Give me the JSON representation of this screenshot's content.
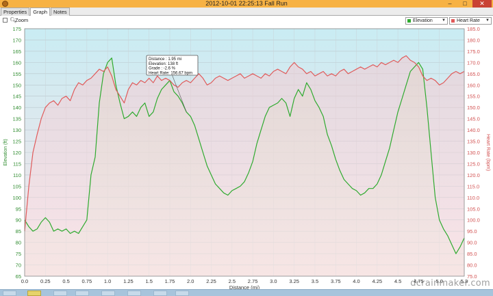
{
  "window": {
    "title": "2012-10-01 22:25:13 Fall Run",
    "minimize": "–",
    "maximize": "□",
    "close": "✕"
  },
  "tabs": [
    {
      "label": "Properties",
      "active": false
    },
    {
      "label": "Graph",
      "active": true
    },
    {
      "label": "Notes",
      "active": false
    }
  ],
  "toolbar": {
    "zoom_label": "Zoom",
    "zoom_checked": false,
    "left_series": {
      "label": "Elevation",
      "color": "#2eaa2e"
    },
    "right_series": {
      "label": "Heart Rate",
      "color": "#e05a5a"
    }
  },
  "watermark": "dcrainmaker.com",
  "chart_data": {
    "type": "line",
    "xlabel": "Distance (mi)",
    "ylabel_left": "Elevation (ft)",
    "ylabel_right": "Heart Rate (bpm)",
    "xlim": [
      0,
      5.3
    ],
    "ylim_left": [
      65,
      175
    ],
    "ylim_right": [
      75,
      185
    ],
    "x_ticks": [
      "0.0",
      "0.25",
      "0.5",
      "0.75",
      "1.0",
      "1.25",
      "1.5",
      "1.75",
      "2.0",
      "2.25",
      "2.5",
      "2.75",
      "3.0",
      "3.25",
      "3.5",
      "3.75",
      "4.0",
      "4.25",
      "4.5",
      "4.75",
      "5.0",
      "5.3"
    ],
    "y_left_ticks": [
      "65",
      "70",
      "75",
      "80",
      "85",
      "90",
      "95",
      "100",
      "105",
      "110",
      "115",
      "120",
      "125",
      "130",
      "135",
      "140",
      "145",
      "150",
      "155",
      "160",
      "165",
      "170",
      "175"
    ],
    "y_right_ticks": [
      "75.0",
      "80.0",
      "85.0",
      "90.0",
      "95.0",
      "100.0",
      "105.0",
      "110.0",
      "115.0",
      "120.0",
      "125.0",
      "130.0",
      "135.0",
      "140.0",
      "145.0",
      "150.0",
      "155.0",
      "160.0",
      "165.0",
      "170.0",
      "175.0",
      "180.0",
      "185.0"
    ],
    "grid": true,
    "series": [
      {
        "name": "Elevation",
        "axis": "left",
        "color": "#2eaa2e",
        "points": [
          [
            0,
            90
          ],
          [
            0.05,
            87
          ],
          [
            0.1,
            85
          ],
          [
            0.15,
            86
          ],
          [
            0.2,
            89
          ],
          [
            0.25,
            91
          ],
          [
            0.3,
            89
          ],
          [
            0.35,
            85
          ],
          [
            0.4,
            86
          ],
          [
            0.45,
            85
          ],
          [
            0.5,
            86
          ],
          [
            0.55,
            84
          ],
          [
            0.6,
            85
          ],
          [
            0.65,
            84
          ],
          [
            0.7,
            87
          ],
          [
            0.75,
            90
          ],
          [
            0.8,
            110
          ],
          [
            0.85,
            118
          ],
          [
            0.9,
            142
          ],
          [
            0.95,
            155
          ],
          [
            1.0,
            160
          ],
          [
            1.05,
            162
          ],
          [
            1.1,
            150
          ],
          [
            1.15,
            142
          ],
          [
            1.2,
            135
          ],
          [
            1.25,
            136
          ],
          [
            1.3,
            138
          ],
          [
            1.35,
            136
          ],
          [
            1.4,
            140
          ],
          [
            1.45,
            142
          ],
          [
            1.5,
            136
          ],
          [
            1.55,
            138
          ],
          [
            1.6,
            144
          ],
          [
            1.65,
            148
          ],
          [
            1.7,
            150
          ],
          [
            1.75,
            152
          ],
          [
            1.8,
            147
          ],
          [
            1.85,
            145
          ],
          [
            1.9,
            142
          ],
          [
            1.95,
            138
          ],
          [
            2.0,
            136
          ],
          [
            2.05,
            132
          ],
          [
            2.1,
            126
          ],
          [
            2.15,
            120
          ],
          [
            2.2,
            114
          ],
          [
            2.25,
            110
          ],
          [
            2.3,
            106
          ],
          [
            2.35,
            104
          ],
          [
            2.4,
            102
          ],
          [
            2.45,
            101
          ],
          [
            2.5,
            103
          ],
          [
            2.55,
            104
          ],
          [
            2.6,
            105
          ],
          [
            2.65,
            107
          ],
          [
            2.7,
            111
          ],
          [
            2.75,
            116
          ],
          [
            2.8,
            124
          ],
          [
            2.85,
            130
          ],
          [
            2.9,
            136
          ],
          [
            2.95,
            140
          ],
          [
            3.0,
            141
          ],
          [
            3.05,
            142
          ],
          [
            3.1,
            144
          ],
          [
            3.15,
            142
          ],
          [
            3.2,
            136
          ],
          [
            3.25,
            144
          ],
          [
            3.3,
            148
          ],
          [
            3.35,
            145
          ],
          [
            3.4,
            151
          ],
          [
            3.45,
            148
          ],
          [
            3.5,
            143
          ],
          [
            3.55,
            140
          ],
          [
            3.6,
            136
          ],
          [
            3.65,
            128
          ],
          [
            3.7,
            123
          ],
          [
            3.75,
            117
          ],
          [
            3.8,
            112
          ],
          [
            3.85,
            108
          ],
          [
            3.9,
            106
          ],
          [
            3.95,
            104
          ],
          [
            4.0,
            103
          ],
          [
            4.05,
            101
          ],
          [
            4.1,
            102
          ],
          [
            4.15,
            104
          ],
          [
            4.2,
            104
          ],
          [
            4.25,
            106
          ],
          [
            4.3,
            110
          ],
          [
            4.35,
            116
          ],
          [
            4.4,
            122
          ],
          [
            4.45,
            130
          ],
          [
            4.5,
            138
          ],
          [
            4.55,
            144
          ],
          [
            4.6,
            150
          ],
          [
            4.65,
            156
          ],
          [
            4.7,
            158
          ],
          [
            4.75,
            160
          ],
          [
            4.8,
            157
          ],
          [
            4.85,
            140
          ],
          [
            4.9,
            120
          ],
          [
            4.95,
            100
          ],
          [
            5.0,
            90
          ],
          [
            5.05,
            86
          ],
          [
            5.1,
            83
          ],
          [
            5.15,
            79
          ],
          [
            5.2,
            75
          ],
          [
            5.25,
            78
          ],
          [
            5.3,
            82
          ]
        ]
      },
      {
        "name": "Heart Rate",
        "axis": "right",
        "color": "#e05a5a",
        "points": [
          [
            0,
            95
          ],
          [
            0.05,
            115
          ],
          [
            0.1,
            130
          ],
          [
            0.15,
            138
          ],
          [
            0.2,
            145
          ],
          [
            0.25,
            150
          ],
          [
            0.3,
            152
          ],
          [
            0.35,
            153
          ],
          [
            0.4,
            151
          ],
          [
            0.45,
            154
          ],
          [
            0.5,
            155
          ],
          [
            0.55,
            153
          ],
          [
            0.6,
            158
          ],
          [
            0.65,
            161
          ],
          [
            0.7,
            160
          ],
          [
            0.75,
            162
          ],
          [
            0.8,
            163
          ],
          [
            0.85,
            165
          ],
          [
            0.9,
            167
          ],
          [
            0.95,
            166
          ],
          [
            1.0,
            168
          ],
          [
            1.05,
            164
          ],
          [
            1.1,
            158
          ],
          [
            1.15,
            155
          ],
          [
            1.2,
            152
          ],
          [
            1.25,
            158
          ],
          [
            1.3,
            161
          ],
          [
            1.35,
            160
          ],
          [
            1.4,
            162
          ],
          [
            1.45,
            161
          ],
          [
            1.5,
            163
          ],
          [
            1.55,
            161
          ],
          [
            1.6,
            164
          ],
          [
            1.65,
            162
          ],
          [
            1.7,
            163
          ],
          [
            1.75,
            162
          ],
          [
            1.8,
            160
          ],
          [
            1.85,
            159
          ],
          [
            1.9,
            161
          ],
          [
            1.95,
            162
          ],
          [
            2.0,
            161
          ],
          [
            2.05,
            163
          ],
          [
            2.1,
            165
          ],
          [
            2.15,
            163
          ],
          [
            2.2,
            160
          ],
          [
            2.25,
            161
          ],
          [
            2.3,
            163
          ],
          [
            2.35,
            164
          ],
          [
            2.4,
            163
          ],
          [
            2.45,
            162
          ],
          [
            2.5,
            163
          ],
          [
            2.55,
            164
          ],
          [
            2.6,
            165
          ],
          [
            2.65,
            163
          ],
          [
            2.7,
            164
          ],
          [
            2.75,
            165
          ],
          [
            2.8,
            164
          ],
          [
            2.85,
            163
          ],
          [
            2.9,
            165
          ],
          [
            2.95,
            164
          ],
          [
            3.0,
            166
          ],
          [
            3.05,
            167
          ],
          [
            3.1,
            166
          ],
          [
            3.15,
            165
          ],
          [
            3.2,
            168
          ],
          [
            3.25,
            170
          ],
          [
            3.3,
            168
          ],
          [
            3.35,
            167
          ],
          [
            3.4,
            165
          ],
          [
            3.45,
            166
          ],
          [
            3.5,
            164
          ],
          [
            3.55,
            165
          ],
          [
            3.6,
            166
          ],
          [
            3.65,
            164
          ],
          [
            3.7,
            165
          ],
          [
            3.75,
            164
          ],
          [
            3.8,
            166
          ],
          [
            3.85,
            167
          ],
          [
            3.9,
            165
          ],
          [
            3.95,
            166
          ],
          [
            4.0,
            167
          ],
          [
            4.05,
            168
          ],
          [
            4.1,
            167
          ],
          [
            4.15,
            168
          ],
          [
            4.2,
            169
          ],
          [
            4.25,
            168
          ],
          [
            4.3,
            170
          ],
          [
            4.35,
            169
          ],
          [
            4.4,
            170
          ],
          [
            4.45,
            171
          ],
          [
            4.5,
            170
          ],
          [
            4.55,
            172
          ],
          [
            4.6,
            173
          ],
          [
            4.65,
            171
          ],
          [
            4.7,
            170
          ],
          [
            4.75,
            168
          ],
          [
            4.8,
            164
          ],
          [
            4.85,
            162
          ],
          [
            4.9,
            163
          ],
          [
            4.95,
            162
          ],
          [
            5.0,
            160
          ],
          [
            5.05,
            161
          ],
          [
            5.1,
            163
          ],
          [
            5.15,
            165
          ],
          [
            5.2,
            166
          ],
          [
            5.25,
            165
          ],
          [
            5.3,
            166
          ]
        ]
      }
    ],
    "tooltip": {
      "at_x": 1.95,
      "lines": [
        "Distance : 1.95 mi",
        "Elevation: 138 ft",
        "Grade : -2.6 %",
        "Heart Rate: 156.67 bpm"
      ]
    }
  }
}
